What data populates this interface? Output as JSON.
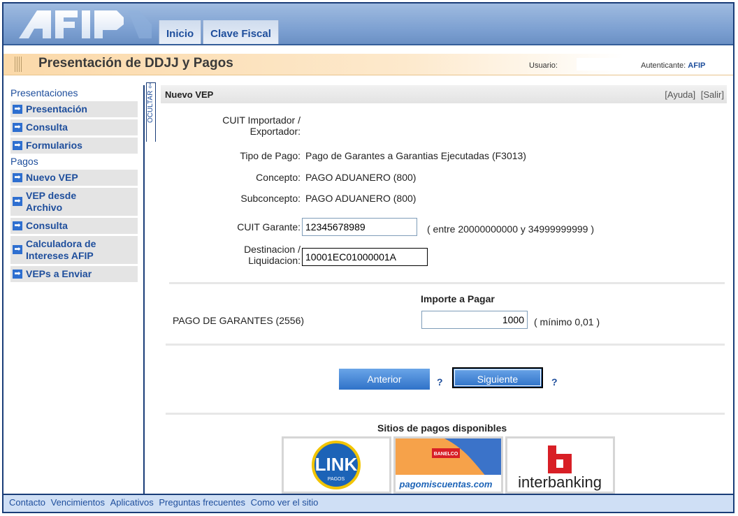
{
  "header": {
    "logo_text": "AFIP",
    "nav": [
      "Inicio",
      "Clave Fiscal"
    ]
  },
  "titlebar": {
    "title": "Presentación de DDJJ y Pagos",
    "user_label": "Usuario:",
    "auth_label": "Autenticante:",
    "auth_value": "AFIP"
  },
  "sidebar": {
    "sections": [
      {
        "title": "Presentaciones",
        "items": [
          "Presentación",
          "Consulta",
          "Formularios"
        ]
      },
      {
        "title": "Pagos",
        "items": [
          "Nuevo VEP",
          "VEP desde Archivo",
          "Consulta",
          "Calculadora de Intereses AFIP",
          "VEPs a Enviar"
        ]
      }
    ],
    "toggle_label": "OCULTAR"
  },
  "main": {
    "panel_title": "Nuevo VEP",
    "help_link": "[Ayuda]",
    "exit_link": "[Salir]",
    "fields": {
      "cuit_imp_label_1": "CUIT Importador /",
      "cuit_imp_label_2": "Exportador:",
      "tipo_pago_label": "Tipo de Pago:",
      "tipo_pago_value": "Pago de Garantes a Garantias Ejecutadas (F3013)",
      "concepto_label": "Concepto:",
      "concepto_value": "PAGO ADUANERO (800)",
      "subconcepto_label": "Subconcepto:",
      "subconcepto_value": "PAGO ADUANERO (800)",
      "cuit_garante_label": "CUIT Garante:",
      "cuit_garante_value": "12345678989",
      "cuit_garante_hint": "( entre 20000000000 y 34999999999 )",
      "destinacion_label_1": "Destinacion /",
      "destinacion_label_2": "Liquidacion:",
      "destinacion_value": "10001EC01000001A"
    },
    "importe_header": "Importe a Pagar",
    "importe_row_label": "PAGO DE GARANTES (2556)",
    "importe_value": "1000",
    "importe_hint": "( mínimo 0,01 )",
    "btn_prev": "Anterior",
    "btn_next": "Siguiente",
    "help_q": "?",
    "sites_title": "Sitios de pagos disponibles",
    "sites": {
      "link": "LINK",
      "link_sub": "PAGOS",
      "banelco": "BANELCO",
      "pmc": "pagomiscuentas.com",
      "interbanking": "interbanking"
    }
  },
  "footer": [
    "Contacto",
    "Vencimientos",
    "Aplicativos",
    "Preguntas frecuentes",
    "Como ver el sitio"
  ],
  "colors": {
    "brand_blue": "#1e4e9c",
    "button_blue": "#2f72c8",
    "title_orange": "#fbd9a9"
  }
}
